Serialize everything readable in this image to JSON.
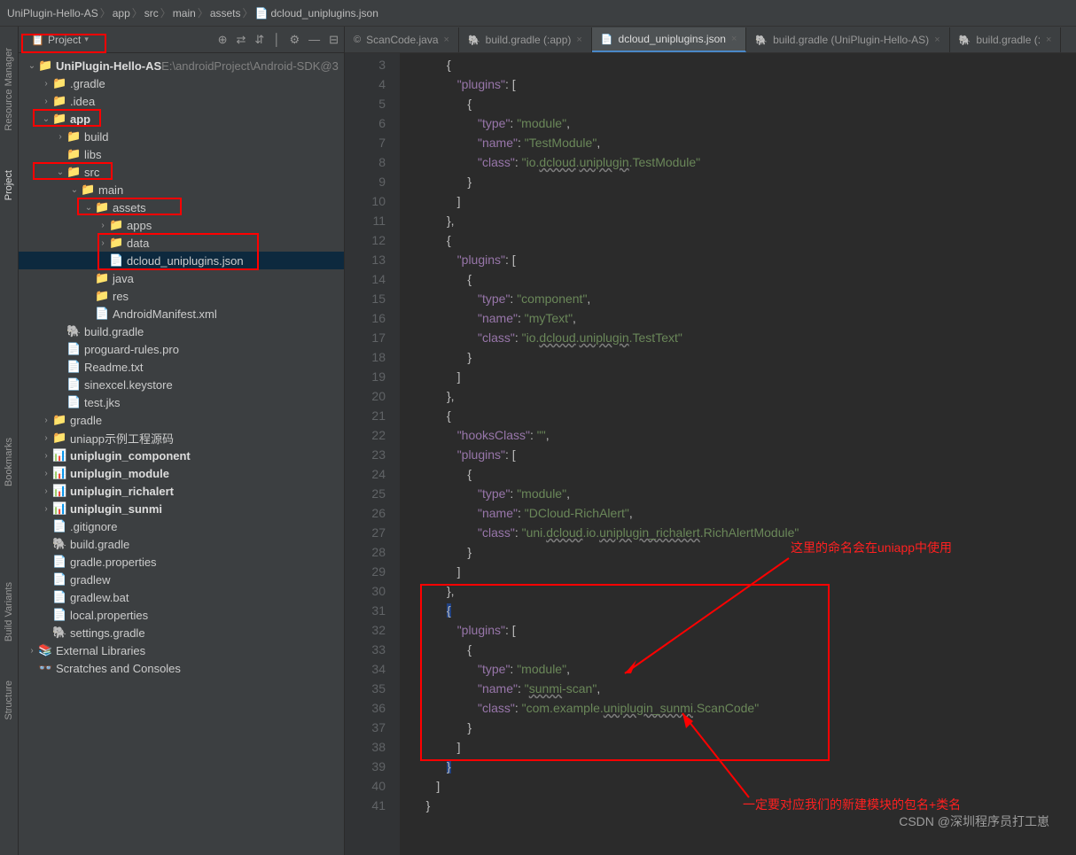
{
  "breadcrumbs": [
    "UniPlugin-Hello-AS",
    "app",
    "src",
    "main",
    "assets",
    "dcloud_uniplugins.json"
  ],
  "project_selector": {
    "label": "Project",
    "icon": "▾"
  },
  "toolbar_hints": [
    "⊕",
    "⇄",
    "⇵",
    "│",
    "⚙",
    "—",
    "⊟"
  ],
  "tree": [
    {
      "d": 0,
      "a": "v",
      "i": "📁",
      "c": "blue-folder",
      "t": "UniPlugin-Hello-AS",
      "suf": " E:\\androidProject\\Android-SDK@3",
      "bold": true
    },
    {
      "d": 1,
      "a": ">",
      "i": "📁",
      "c": "folder-icon",
      "t": ".gradle"
    },
    {
      "d": 1,
      "a": ">",
      "i": "📁",
      "c": "folder-icon",
      "t": ".idea"
    },
    {
      "d": 1,
      "a": "v",
      "i": "📁",
      "c": "blue-folder",
      "t": "app",
      "bold": true,
      "box": true
    },
    {
      "d": 2,
      "a": ">",
      "i": "📁",
      "c": "folder-icon",
      "t": "build"
    },
    {
      "d": 2,
      "a": "",
      "i": "📁",
      "c": "folder-icon",
      "t": "libs"
    },
    {
      "d": 2,
      "a": "v",
      "i": "📁",
      "c": "blue-folder",
      "t": "src",
      "box": true
    },
    {
      "d": 3,
      "a": "v",
      "i": "📁",
      "c": "blue-folder",
      "t": "main"
    },
    {
      "d": 4,
      "a": "v",
      "i": "📁",
      "c": "folder-icon",
      "t": "assets",
      "box": true
    },
    {
      "d": 5,
      "a": ">",
      "i": "📁",
      "c": "folder-icon",
      "t": "apps"
    },
    {
      "d": 5,
      "a": ">",
      "i": "📁",
      "c": "folder-icon",
      "t": "data",
      "bigbox": "start"
    },
    {
      "d": 5,
      "a": "",
      "i": "📄",
      "c": "json-icon",
      "t": "dcloud_uniplugins.json",
      "sel": true,
      "bigbox": "end"
    },
    {
      "d": 4,
      "a": "",
      "i": "📁",
      "c": "blue-folder",
      "t": "java"
    },
    {
      "d": 4,
      "a": "",
      "i": "📁",
      "c": "folder-icon",
      "t": "res"
    },
    {
      "d": 4,
      "a": "",
      "i": "📄",
      "c": "xml-icon",
      "t": "AndroidManifest.xml"
    },
    {
      "d": 2,
      "a": "",
      "i": "🐘",
      "c": "gradle-icon",
      "t": "build.gradle"
    },
    {
      "d": 2,
      "a": "",
      "i": "📄",
      "c": "file-icon",
      "t": "proguard-rules.pro"
    },
    {
      "d": 2,
      "a": "",
      "i": "📄",
      "c": "file-icon",
      "t": "Readme.txt"
    },
    {
      "d": 2,
      "a": "",
      "i": "📄",
      "c": "file-icon",
      "t": "sinexcel.keystore"
    },
    {
      "d": 2,
      "a": "",
      "i": "📄",
      "c": "file-icon",
      "t": "test.jks"
    },
    {
      "d": 1,
      "a": ">",
      "i": "📁",
      "c": "folder-icon",
      "t": "gradle"
    },
    {
      "d": 1,
      "a": ">",
      "i": "📁",
      "c": "folder-icon",
      "t": "uniapp示例工程源码"
    },
    {
      "d": 1,
      "a": ">",
      "i": "📊",
      "c": "blue-folder",
      "t": "uniplugin_component",
      "bold": true
    },
    {
      "d": 1,
      "a": ">",
      "i": "📊",
      "c": "blue-folder",
      "t": "uniplugin_module",
      "bold": true
    },
    {
      "d": 1,
      "a": ">",
      "i": "📊",
      "c": "blue-folder",
      "t": "uniplugin_richalert",
      "bold": true
    },
    {
      "d": 1,
      "a": ">",
      "i": "📊",
      "c": "blue-folder",
      "t": "uniplugin_sunmi",
      "bold": true
    },
    {
      "d": 1,
      "a": "",
      "i": "📄",
      "c": "file-icon",
      "t": ".gitignore"
    },
    {
      "d": 1,
      "a": "",
      "i": "🐘",
      "c": "gradle-icon",
      "t": "build.gradle"
    },
    {
      "d": 1,
      "a": "",
      "i": "📄",
      "c": "gradle-icon",
      "t": "gradle.properties"
    },
    {
      "d": 1,
      "a": "",
      "i": "📄",
      "c": "file-icon",
      "t": "gradlew"
    },
    {
      "d": 1,
      "a": "",
      "i": "📄",
      "c": "file-icon",
      "t": "gradlew.bat"
    },
    {
      "d": 1,
      "a": "",
      "i": "📄",
      "c": "file-icon",
      "t": "local.properties"
    },
    {
      "d": 1,
      "a": "",
      "i": "🐘",
      "c": "gradle-icon",
      "t": "settings.gradle"
    },
    {
      "d": 0,
      "a": ">",
      "i": "📚",
      "c": "file-icon",
      "t": "External Libraries"
    },
    {
      "d": 0,
      "a": "",
      "i": "👓",
      "c": "file-icon",
      "t": "Scratches and Consoles"
    }
  ],
  "rails": [
    "Resource Manager",
    "Project",
    "Bookmarks",
    "Build Variants",
    "Structure"
  ],
  "tabs": [
    {
      "icon": "©",
      "t": "ScanCode.java"
    },
    {
      "icon": "🐘",
      "t": "build.gradle (:app)"
    },
    {
      "icon": "📄",
      "t": "dcloud_uniplugins.json",
      "active": true
    },
    {
      "icon": "🐘",
      "t": "build.gradle (UniPlugin-Hello-AS)"
    },
    {
      "icon": "🐘",
      "t": "build.gradle (:"
    }
  ],
  "code_lines": [
    {
      "n": 3,
      "h": "         {"
    },
    {
      "n": 4,
      "h": "            <k>\"plugins\"</k>: ["
    },
    {
      "n": 5,
      "h": "               {"
    },
    {
      "n": 6,
      "h": "                  <k>\"type\"</k>: <s>\"module\"</s>,"
    },
    {
      "n": 7,
      "h": "                  <k>\"name\"</k>: <s>\"TestModule\"</s>,"
    },
    {
      "n": 8,
      "h": "                  <k>\"class\"</k>: <s>\"io.<w>dcloud</w>.<w>uniplugin</w>.TestModule\"</s>"
    },
    {
      "n": 9,
      "h": "               }"
    },
    {
      "n": 10,
      "h": "            ]"
    },
    {
      "n": 11,
      "h": "         },"
    },
    {
      "n": 12,
      "h": "         {"
    },
    {
      "n": 13,
      "h": "            <k>\"plugins\"</k>: ["
    },
    {
      "n": 14,
      "h": "               {"
    },
    {
      "n": 15,
      "h": "                  <k>\"type\"</k>: <s>\"component\"</s>,"
    },
    {
      "n": 16,
      "h": "                  <k>\"name\"</k>: <s>\"myText\"</s>,"
    },
    {
      "n": 17,
      "h": "                  <k>\"class\"</k>: <s>\"io.<w>dcloud</w>.<w>uniplugin</w>.TestText\"</s>"
    },
    {
      "n": 18,
      "h": "               }"
    },
    {
      "n": 19,
      "h": "            ]"
    },
    {
      "n": 20,
      "h": "         },"
    },
    {
      "n": 21,
      "h": "         {"
    },
    {
      "n": 22,
      "h": "            <k>\"hooksClass\"</k>: <s>\"\"</s>,"
    },
    {
      "n": 23,
      "h": "            <k>\"plugins\"</k>: ["
    },
    {
      "n": 24,
      "h": "               {"
    },
    {
      "n": 25,
      "h": "                  <k>\"type\"</k>: <s>\"module\"</s>,"
    },
    {
      "n": 26,
      "h": "                  <k>\"name\"</k>: <s>\"DCloud-RichAlert\"</s>,"
    },
    {
      "n": 27,
      "h": "                  <k>\"class\"</k>: <s>\"uni.<w>dcloud</w>.io.<w>uniplugin_richalert</w>.RichAlertModule\"</s>"
    },
    {
      "n": 28,
      "h": "               }"
    },
    {
      "n": 29,
      "h": "            ]"
    },
    {
      "n": 30,
      "h": "         },"
    },
    {
      "n": 31,
      "h": "         <hl>{</hl>"
    },
    {
      "n": 32,
      "h": "            <k>\"plugins\"</k>: ["
    },
    {
      "n": 33,
      "h": "               {"
    },
    {
      "n": 34,
      "h": "                  <k>\"type\"</k>: <s>\"module\"</s>,"
    },
    {
      "n": 35,
      "h": "                  <k>\"name\"</k>: <s>\"<w>sunmi</w>-scan\"</s>,"
    },
    {
      "n": 36,
      "h": "                  <k>\"class\"</k>: <s>\"com.example.<w>uniplugin_sunmi</w>.ScanCode\"</s>"
    },
    {
      "n": 37,
      "h": "               }"
    },
    {
      "n": 38,
      "h": "            ]"
    },
    {
      "n": 39,
      "h": "         <hl>}</hl>"
    },
    {
      "n": 40,
      "h": "      ]"
    },
    {
      "n": 41,
      "h": "   }"
    }
  ],
  "annotations": {
    "top": "这里的命名会在uniapp中使用",
    "bottom": "一定要对应我们的新建模块的包名+类名"
  },
  "watermark": "CSDN @深圳程序员打工崽"
}
